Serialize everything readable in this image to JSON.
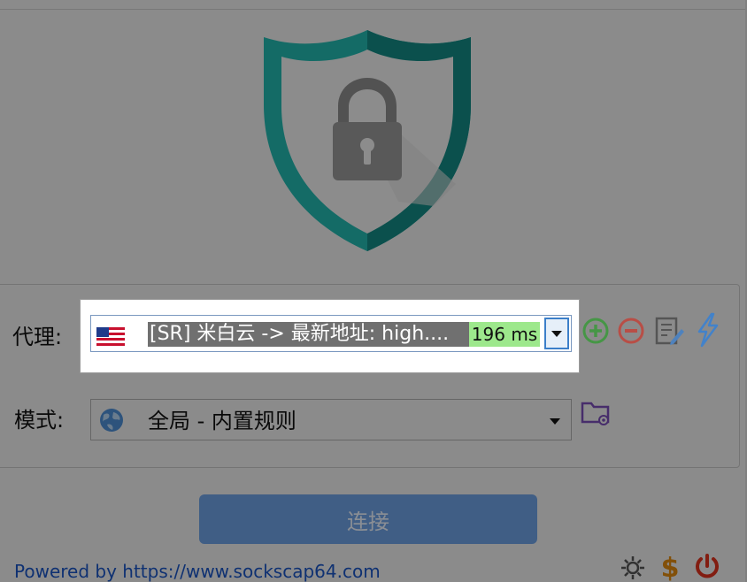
{
  "proxy": {
    "label": "代理:",
    "selected": "[SR] 米白云 -> 最新地址: high....",
    "latency": "196 ms",
    "flag_icon": "us-flag-icon"
  },
  "mode": {
    "label": "模式:",
    "selected": "全局 - 内置规则",
    "icon": "globe-icon"
  },
  "actions": {
    "connect_label": "连接"
  },
  "footer": {
    "powered_by": "Powered by https://www.sockscap64.com"
  },
  "colors": {
    "shield": "#1ba6a0",
    "connect_button": "#6ea2e6",
    "latency_bg": "#9de88c",
    "selection_bg": "#707070",
    "link": "#1a55c5"
  }
}
